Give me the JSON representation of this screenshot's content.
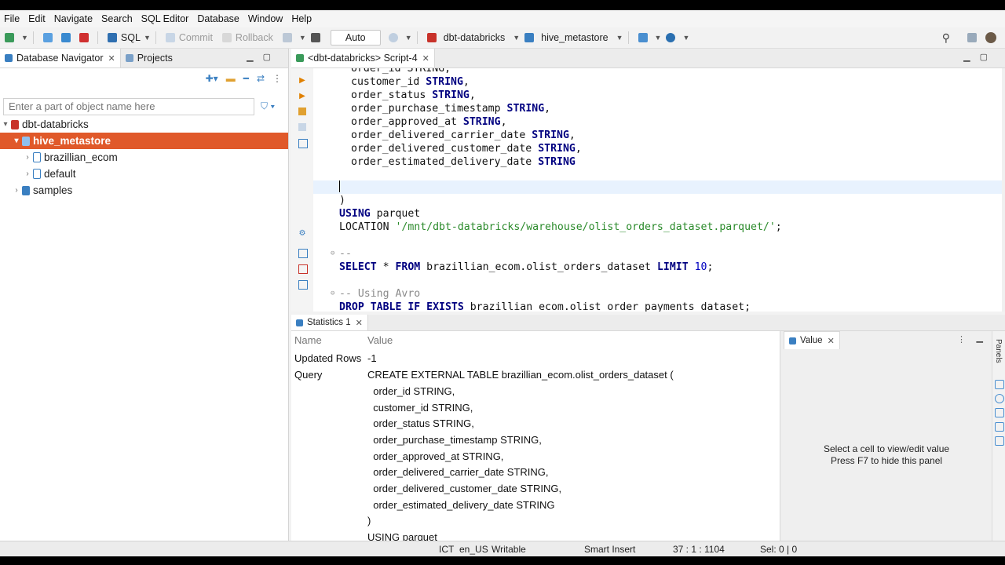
{
  "menu": [
    "File",
    "Edit",
    "Navigate",
    "Search",
    "SQL Editor",
    "Database",
    "Window",
    "Help"
  ],
  "toolbar": {
    "sql_label": "SQL",
    "commit_label": "Commit",
    "rollback_label": "Rollback",
    "mode_label": "Auto",
    "connection": "dbt-databricks",
    "catalog": "hive_metastore"
  },
  "left": {
    "tabs": [
      "Database Navigator",
      "Projects"
    ],
    "filter_placeholder": "Enter a part of object name here",
    "tree": {
      "root": "dbt-databricks",
      "selected": "hive_metastore",
      "children": [
        "brazillian_ecom",
        "default"
      ],
      "other": "samples"
    }
  },
  "editor": {
    "tab_title": "<dbt-databricks> Script-4",
    "lines": [
      "order_id STRING,",
      "customer_id STRING,",
      "order_status STRING,",
      "order_purchase_timestamp STRING,",
      "order_approved_at STRING,",
      "order_delivered_carrier_date STRING,",
      "order_delivered_customer_date STRING,",
      "order_estimated_delivery_date STRING",
      ")",
      "USING parquet",
      "LOCATION '/mnt/dbt-databricks/warehouse/olist_orders_dataset.parquet/';",
      "--",
      "SELECT * FROM brazillian_ecom.olist_orders_dataset LIMIT 10;",
      "-- Using Avro",
      "DROP TABLE IF EXISTS brazillian_ecom.olist_order_payments_dataset;"
    ]
  },
  "results": {
    "tab": "Statistics 1",
    "col_name": "Name",
    "col_value": "Value",
    "updated_rows_label": "Updated Rows",
    "updated_rows_value": "-1",
    "query_label": "Query",
    "query_lines": [
      "CREATE EXTERNAL TABLE brazillian_ecom.olist_orders_dataset (",
      "  order_id STRING,",
      "  customer_id STRING,",
      "  order_status STRING,",
      "  order_purchase_timestamp STRING,",
      "  order_approved_at STRING,",
      "  order_delivered_carrier_date STRING,",
      "  order_delivered_customer_date STRING,",
      "  order_estimated_delivery_date STRING",
      ")",
      "USING parquet"
    ],
    "value_tab": "Value",
    "value_msg1": "Select a cell to view/edit value",
    "value_msg2": "Press F7 to hide this panel",
    "panels_label": "Panels"
  },
  "status": {
    "timezone": "ICT",
    "locale": "en_US",
    "mode": "Writable",
    "insert": "Smart Insert",
    "position": "37 : 1 : 1104",
    "selection": "Sel: 0 | 0"
  },
  "colors": {
    "accent": "#e0592a",
    "keyword": "#000080",
    "string": "#2a8a2a"
  }
}
